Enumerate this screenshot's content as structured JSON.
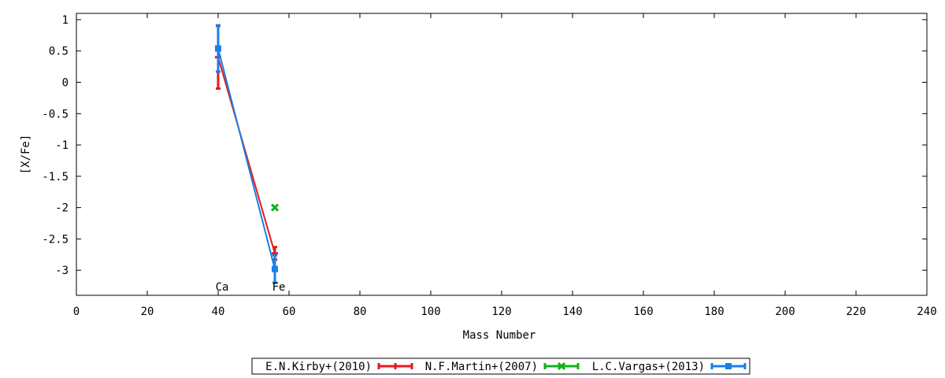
{
  "chart_data": {
    "type": "line",
    "xlabel": "Mass Number",
    "ylabel": "[X/Fe]",
    "xlim": [
      0,
      240
    ],
    "ylim": [
      -3.4,
      1.1
    ],
    "xticks": [
      0,
      20,
      40,
      60,
      80,
      100,
      120,
      140,
      160,
      180,
      200,
      220,
      240
    ],
    "yticks": [
      1,
      0.5,
      0,
      -0.5,
      -1,
      -1.5,
      -2,
      -2.5,
      -3
    ],
    "element_labels": [
      {
        "text": "Ca",
        "x": 40
      },
      {
        "text": "Fe",
        "x": 56
      }
    ],
    "legend_position": "bottom-center",
    "series": [
      {
        "name": "E.N.Kirby+(2010)",
        "color": "#e41a1c",
        "marker": "plus",
        "points": [
          {
            "x": 40,
            "y": 0.4,
            "err": 0.5
          },
          {
            "x": 56,
            "y": -2.73,
            "err": 0.1
          }
        ]
      },
      {
        "name": "N.F.Martin+(2007)",
        "color": "#13b21a",
        "marker": "cross",
        "points": [
          {
            "x": 56,
            "y": -2.0,
            "err": 0
          }
        ]
      },
      {
        "name": "L.C.Vargas+(2013)",
        "color": "#1a7fe6",
        "marker": "square",
        "points": [
          {
            "x": 40,
            "y": 0.54,
            "err": 0.37
          },
          {
            "x": 56,
            "y": -2.98,
            "err": 0.22
          }
        ]
      }
    ]
  }
}
